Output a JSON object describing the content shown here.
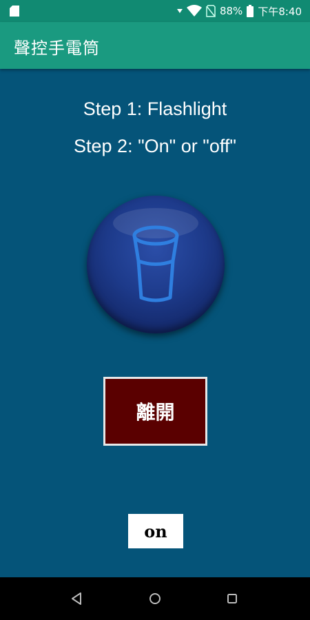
{
  "status_bar": {
    "battery_percent": "88%",
    "time": "下午8:40"
  },
  "app_bar": {
    "title": "聲控手電筒"
  },
  "instructions": {
    "step1": "Step 1:  Flashlight",
    "step2": "Step 2: \"On\" or \"off\""
  },
  "flashlight_button": {
    "icon": "flashlight-icon",
    "state": "off"
  },
  "exit_button": {
    "label": "離開"
  },
  "voice_result": {
    "text": "on"
  },
  "nav_bar": {
    "back_icon": "back-triangle-icon",
    "home_icon": "home-circle-icon",
    "recent_icon": "recent-square-icon"
  },
  "colors": {
    "status_bar_bg": "#118a72",
    "app_bar_bg": "#1a9a80",
    "screen_bg": "#055479",
    "flash_button_bg": "#1d3a8a",
    "flash_icon_stroke": "#2f7fe0",
    "exit_button_bg": "#5a0000"
  }
}
